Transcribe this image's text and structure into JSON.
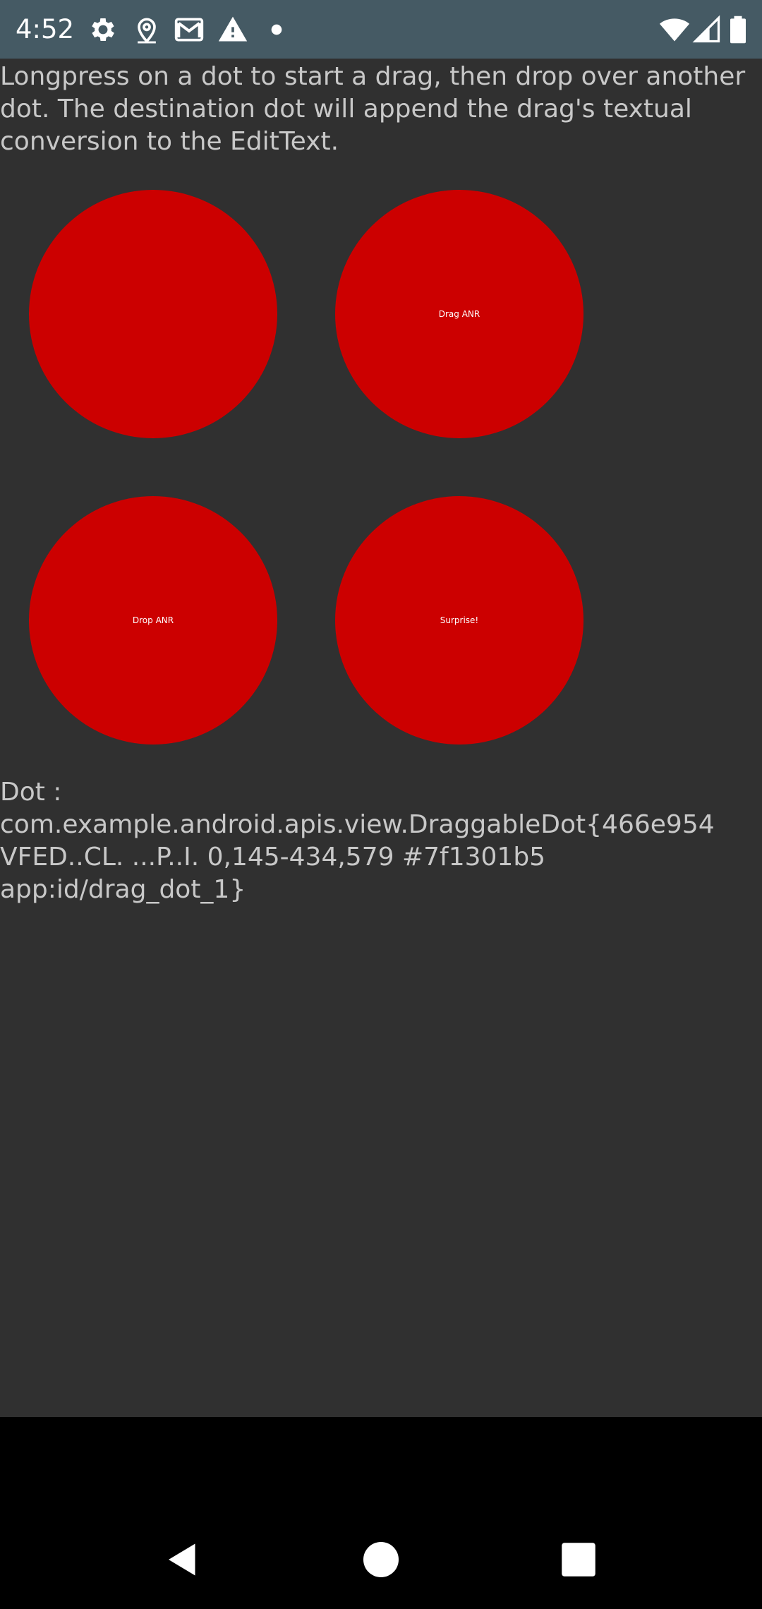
{
  "status_bar": {
    "time": "4:52",
    "left_icons": [
      "settings-icon",
      "location-icon",
      "gmail-icon",
      "warning-icon",
      "dot-icon"
    ],
    "right_icons": [
      "wifi-icon",
      "cell-signal-icon",
      "battery-icon"
    ],
    "background": "#455a64"
  },
  "main": {
    "instructions": "Longpress on a dot to start a drag, then drop over another dot. The destination dot will append the drag's textual conversion to the EditText.",
    "dots": [
      {
        "label": ""
      },
      {
        "label": "Drag ANR"
      },
      {
        "label": "Drop ANR"
      },
      {
        "label": "Surprise!"
      }
    ],
    "dot_color": "#cc0000",
    "dot_info": "Dot : com.example.android.apis.view.DraggableDot{466e954 VFED..CL. ...P..I. 0,145-434,579 #7f1301b5 app:id/drag_dot_1}"
  },
  "nav_bar": {
    "buttons": [
      "back-icon",
      "home-icon",
      "recents-icon"
    ]
  }
}
